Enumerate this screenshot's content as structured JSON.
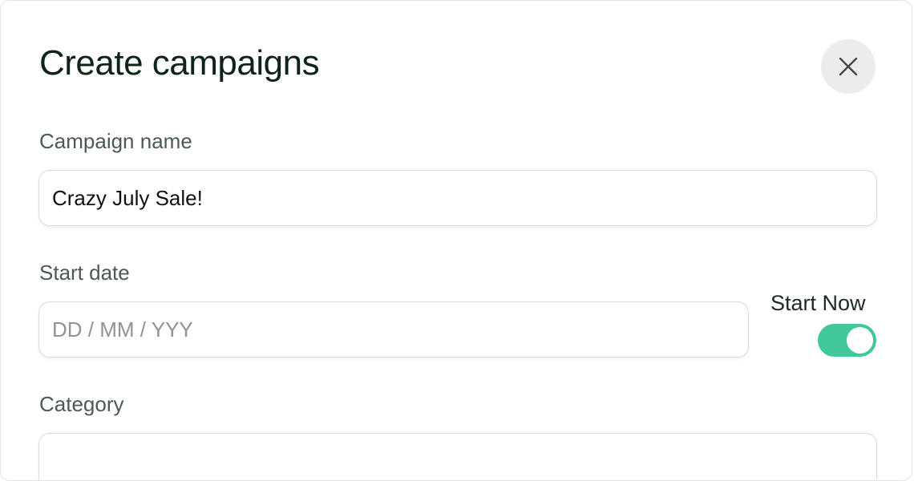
{
  "dialog": {
    "title": "Create campaigns",
    "close_icon": "close-icon"
  },
  "campaign_name": {
    "label": "Campaign name",
    "value": "Crazy July Sale!"
  },
  "start_date": {
    "label": "Start date",
    "placeholder": "DD / MM / YYY",
    "value": ""
  },
  "start_now": {
    "label": "Start Now",
    "enabled": true,
    "accent_color": "#42c79a"
  },
  "category": {
    "label": "Category",
    "value": ""
  }
}
